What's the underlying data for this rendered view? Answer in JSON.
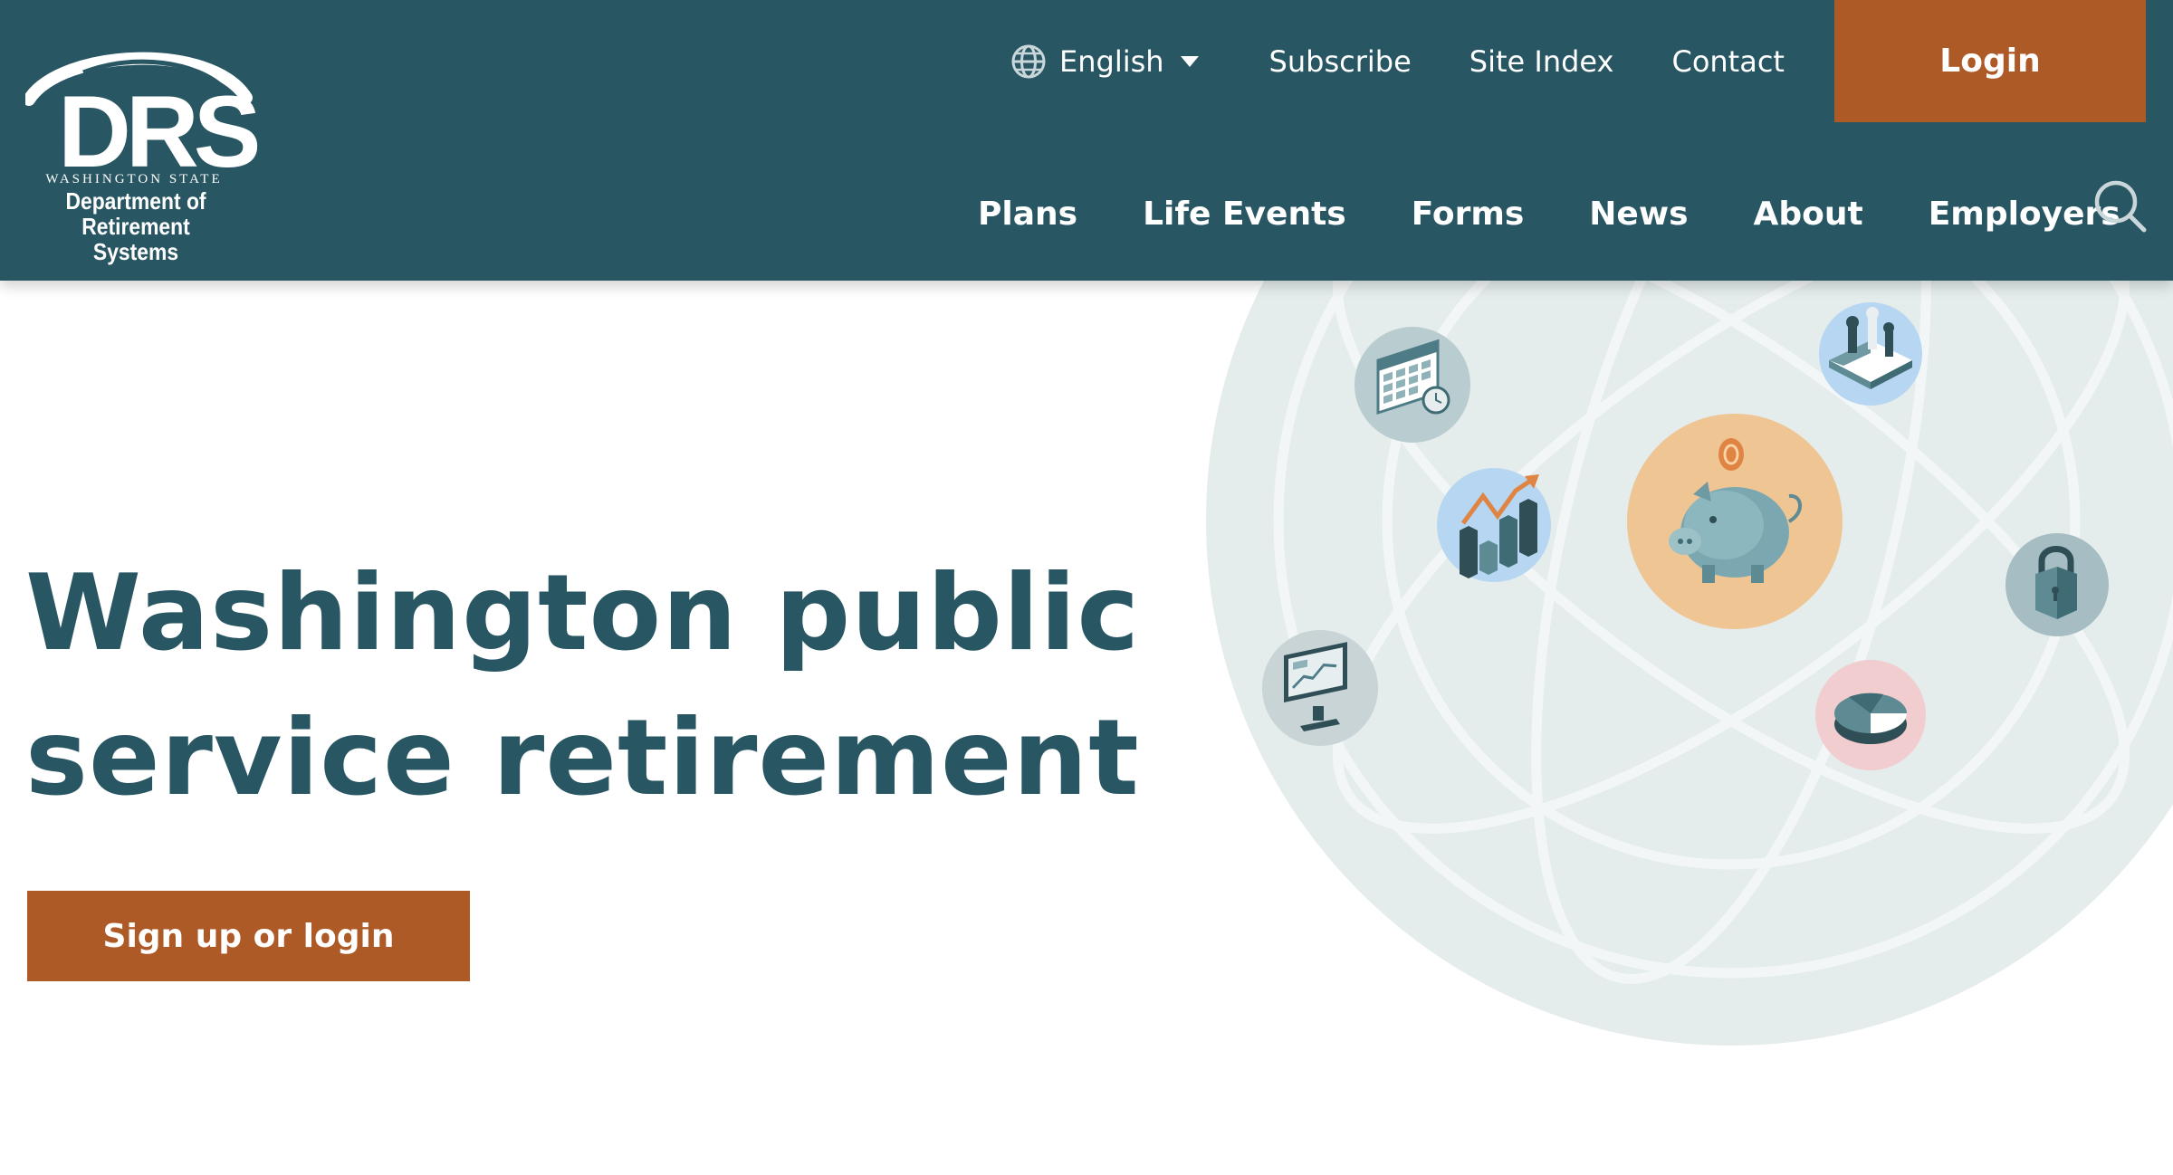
{
  "header": {
    "logo": {
      "wordmark": "DRS",
      "state": "WASHINGTON STATE",
      "department_line1": "Department of",
      "department_line2": "Retirement Systems"
    },
    "utility_nav": {
      "language": "English",
      "subscribe": "Subscribe",
      "site_index": "Site Index",
      "contact": "Contact"
    },
    "login_label": "Login",
    "main_nav": [
      "Plans",
      "Life Events",
      "Forms",
      "News",
      "About",
      "Employers"
    ]
  },
  "hero": {
    "title_line1": "Washington public",
    "title_line2": "service retirement",
    "cta_label": "Sign up or login"
  },
  "illustration": {
    "icons": [
      "calendar-icon",
      "chess-icon",
      "growth-chart-icon",
      "piggy-bank-icon",
      "padlock-icon",
      "computer-monitor-icon",
      "pie-chart-icon"
    ]
  },
  "colors": {
    "header_bg": "#285663",
    "accent": "#ad5a27",
    "hero_text": "#285663",
    "globe": "#e4ecec"
  }
}
